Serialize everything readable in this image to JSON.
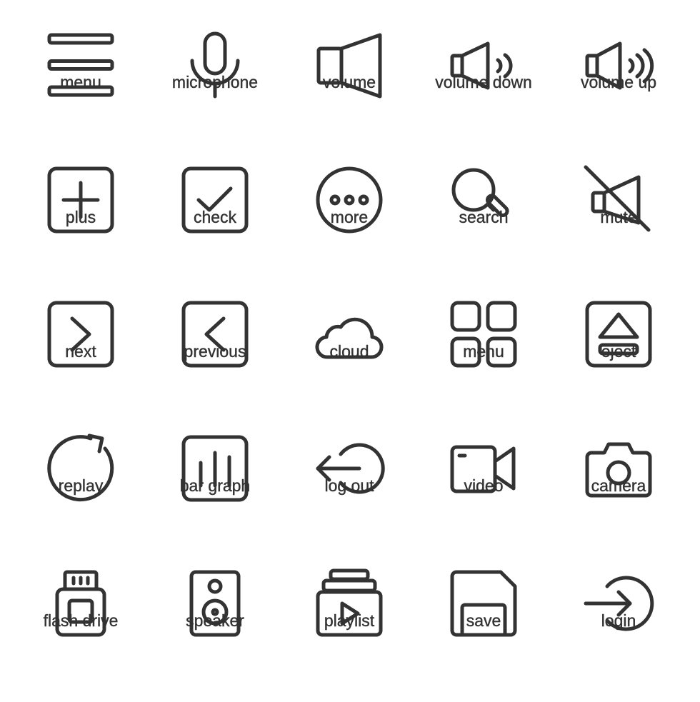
{
  "icon_color": "#333333",
  "icons": [
    {
      "id": "menu-lines",
      "label": "menu"
    },
    {
      "id": "microphone",
      "label": "microphone"
    },
    {
      "id": "volume",
      "label": "volume"
    },
    {
      "id": "volume-down",
      "label": "volume down"
    },
    {
      "id": "volume-up",
      "label": "volume up"
    },
    {
      "id": "plus",
      "label": "plus"
    },
    {
      "id": "check",
      "label": "check"
    },
    {
      "id": "more",
      "label": "more"
    },
    {
      "id": "search",
      "label": "search"
    },
    {
      "id": "mute",
      "label": "mute"
    },
    {
      "id": "next",
      "label": "next"
    },
    {
      "id": "previous",
      "label": "previous"
    },
    {
      "id": "cloud",
      "label": "cloud"
    },
    {
      "id": "menu-grid",
      "label": "menu"
    },
    {
      "id": "eject",
      "label": "eject"
    },
    {
      "id": "replay",
      "label": "replay"
    },
    {
      "id": "bar-graph",
      "label": "bar graph"
    },
    {
      "id": "log-out",
      "label": "log out"
    },
    {
      "id": "video",
      "label": "video"
    },
    {
      "id": "camera",
      "label": "camera"
    },
    {
      "id": "flash-drive",
      "label": "flash drive"
    },
    {
      "id": "speaker",
      "label": "speaker"
    },
    {
      "id": "playlist",
      "label": "playlist"
    },
    {
      "id": "save",
      "label": "save"
    },
    {
      "id": "login",
      "label": "login"
    }
  ]
}
